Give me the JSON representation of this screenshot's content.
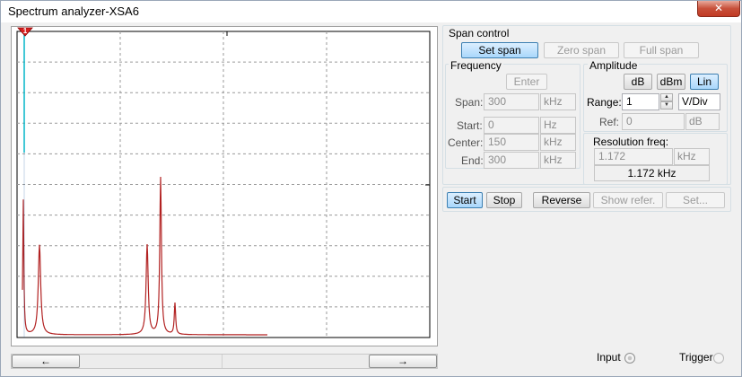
{
  "window": {
    "title": "Spectrum analyzer-XSA6",
    "close_icon": "close-icon",
    "close_glyph": "✕"
  },
  "graph": {
    "marker_label": "1",
    "scroll_left_glyph": "←",
    "scroll_right_glyph": "→",
    "trace_color": "#b22222",
    "cursor_color": "#00c8d0"
  },
  "span_control": {
    "label": "Span control",
    "set_span": "Set span",
    "zero_span": "Zero span",
    "full_span": "Full span"
  },
  "frequency": {
    "label": "Frequency",
    "enter": "Enter",
    "span_label": "Span:",
    "span_value": "300",
    "span_unit": "kHz",
    "start_label": "Start:",
    "start_value": "0",
    "start_unit": "Hz",
    "center_label": "Center:",
    "center_value": "150",
    "center_unit": "kHz",
    "end_label": "End:",
    "end_value": "300",
    "end_unit": "kHz"
  },
  "amplitude": {
    "label": "Amplitude",
    "db": "dB",
    "dbm": "dBm",
    "lin": "Lin",
    "range_label": "Range:",
    "range_value": "1",
    "range_unit": "V/Div",
    "ref_label": "Ref:",
    "ref_value": "0",
    "ref_unit": "dB"
  },
  "resolution": {
    "label": "Resolution freq:",
    "value": "1.172",
    "unit": "kHz",
    "display": "1.172 kHz"
  },
  "controls": {
    "start": "Start",
    "stop": "Stop",
    "reverse": "Reverse",
    "show_refer": "Show refer.",
    "set": "Set..."
  },
  "io": {
    "input": "Input",
    "trigger": "Trigger"
  }
}
